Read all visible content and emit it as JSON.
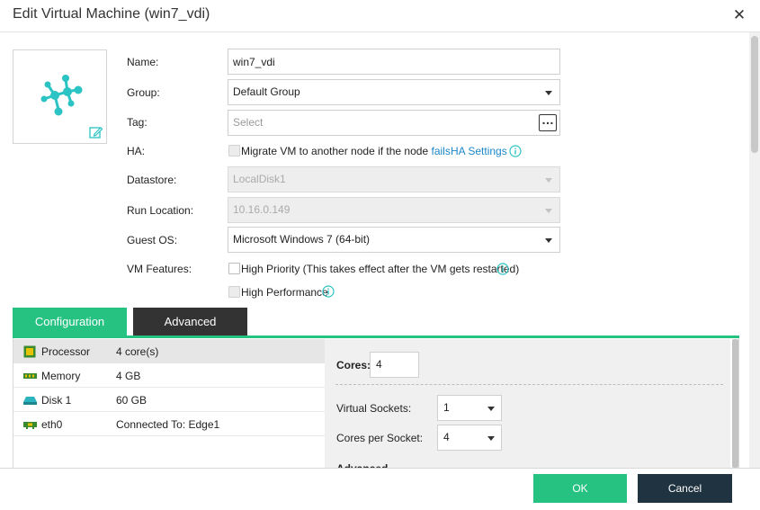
{
  "dialog": {
    "title": "Edit Virtual Machine (win7_vdi)",
    "close_icon": "close-icon"
  },
  "form": {
    "name_label": "Name:",
    "name_value": "win7_vdi",
    "group_label": "Group:",
    "group_value": "Default Group",
    "tag_label": "Tag:",
    "tag_placeholder": "Select",
    "ha_label": "HA:",
    "ha_text": "Migrate VM to another node if the node",
    "ha_fails_link": "fails",
    "ha_settings_link": "HA Settings",
    "datastore_label": "Datastore:",
    "datastore_value": "LocalDisk1",
    "run_location_label": "Run Location:",
    "run_location_value": "10.16.0.149",
    "guest_os_label": "Guest OS:",
    "guest_os_value": "Microsoft Windows 7 (64-bit)",
    "vm_features_label": "VM Features:",
    "high_priority_text": "High Priority (This takes effect after the VM gets restarted)",
    "high_performance_text": "High Performance"
  },
  "tabs": [
    {
      "label": "Configuration",
      "active": true
    },
    {
      "label": "Advanced",
      "active": false
    }
  ],
  "hardware": [
    {
      "name": "Processor",
      "value": "4 core(s)",
      "icon": "processor-icon",
      "selected": true
    },
    {
      "name": "Memory",
      "value": "4 GB",
      "icon": "memory-icon",
      "selected": false
    },
    {
      "name": "Disk 1",
      "value": "60 GB",
      "icon": "disk-icon",
      "selected": false
    },
    {
      "name": "eth0",
      "value": "Connected To: Edge1",
      "icon": "network-icon",
      "selected": false
    }
  ],
  "processor_detail": {
    "cores_label": "Cores:",
    "cores_value": "4",
    "virtual_sockets_label": "Virtual Sockets:",
    "virtual_sockets_value": "1",
    "cores_per_socket_label": "Cores per Socket:",
    "cores_per_socket_value": "4",
    "advanced_label": "Advanced"
  },
  "footer": {
    "ok_label": "OK",
    "cancel_label": "Cancel"
  },
  "colors": {
    "accent": "#26c281",
    "dark": "#333333",
    "cancel": "#203340",
    "link": "#1b87c9"
  }
}
